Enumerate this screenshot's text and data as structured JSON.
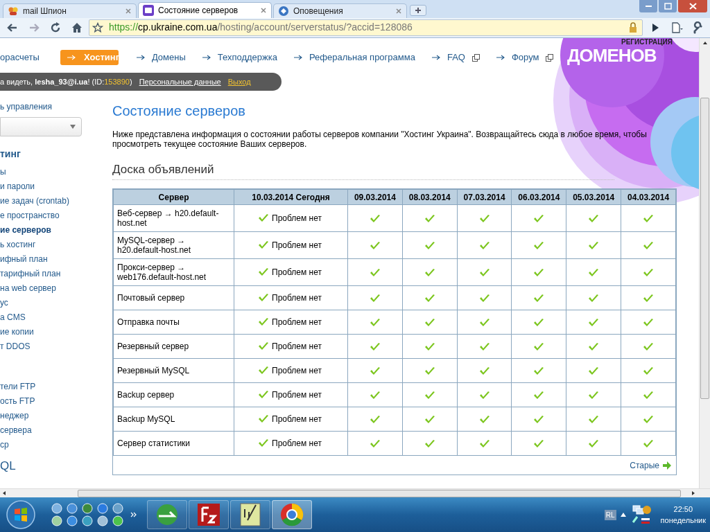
{
  "browser": {
    "tabs": [
      {
        "title": "mail Шпион",
        "selected": false
      },
      {
        "title": "Состояние серверов",
        "selected": true
      },
      {
        "title": "Оповещения",
        "selected": false
      }
    ],
    "url": {
      "scheme": "https://",
      "host": "cp.ukraine.com.ua",
      "path": "/hosting/account/serverstatus/?accid=128086"
    }
  },
  "nav": [
    {
      "label": "орасчеты",
      "selected": false
    },
    {
      "label": "Хостинг",
      "selected": true
    },
    {
      "label": "Домены",
      "selected": false
    },
    {
      "label": "Техподдержка",
      "selected": false
    },
    {
      "label": "Реферальная программа",
      "selected": false
    },
    {
      "label": "FAQ",
      "selected": false,
      "external": true
    },
    {
      "label": "Форум",
      "selected": false,
      "external": true
    }
  ],
  "banner": {
    "top": "РЕГИСТРАЦИЯ",
    "main": "ДОМЕНОВ"
  },
  "user_bar": {
    "greeting": "а видеть, **lesha_93@i.ua**! (ID:",
    "id": "153890",
    "close": ")",
    "links": [
      "Персональные данные",
      "Выход"
    ]
  },
  "sidebar": {
    "title": "ь управления",
    "groups": [
      {
        "heading": "тинг",
        "items": [
          {
            "label": "ы",
            "selected": false
          },
          {
            "label": "и пароли",
            "selected": false
          },
          {
            "label": "ие задач (crontab)",
            "selected": false
          },
          {
            "label": "е пространство",
            "selected": false
          },
          {
            "label": "ие серверов",
            "selected": true
          },
          {
            "label": "ь хостинг",
            "selected": false
          },
          {
            "label": "ифный план",
            "selected": false
          },
          {
            "label": "тарифный план",
            "selected": false
          },
          {
            "label": "на web сервер",
            "selected": false
          },
          {
            "label": "ус",
            "selected": false
          },
          {
            "label": "а CMS",
            "selected": false
          },
          {
            "label": "ие копии",
            "selected": false
          },
          {
            "label": "т DDOS",
            "selected": false
          }
        ]
      },
      {
        "items": [
          {
            "label": "тели FTP",
            "selected": false
          },
          {
            "label": "ость FTP",
            "selected": false
          },
          {
            "label": "неджер",
            "selected": false
          },
          {
            "label": "сервера",
            "selected": false
          },
          {
            "label": "ср",
            "selected": false
          }
        ]
      },
      {
        "heading": "QL"
      }
    ]
  },
  "main": {
    "title": "Состояние серверов",
    "intro": "Ниже представлена информация о состоянии работы серверов компании \"Хостинг Украина\". Возвращайтесь сюда в любое время, чтобы просмотреть текущее состояние Ваших серверов.",
    "board_title": "Доска объявлений",
    "table": {
      "columns": [
        "Сервер",
        "10.03.2014 Сегодня",
        "09.03.2014",
        "08.03.2014",
        "07.03.2014",
        "06.03.2014",
        "05.03.2014",
        "04.03.2014"
      ],
      "rows": [
        {
          "server": "Веб-сервер → h20.default-host.net",
          "today": {
            "ok": true,
            "text": "Проблем нет"
          },
          "days": [
            {
              "ok": true
            },
            {
              "ok": true
            },
            {
              "ok": true
            },
            {
              "ok": true
            },
            {
              "ok": true
            },
            {
              "ok": true
            }
          ]
        },
        {
          "server": "MySQL-сервер → h20.default-host.net",
          "today": {
            "ok": true,
            "text": "Проблем нет"
          },
          "days": [
            {
              "ok": true
            },
            {
              "ok": true
            },
            {
              "ok": true
            },
            {
              "ok": true
            },
            {
              "ok": true
            },
            {
              "ok": true
            }
          ]
        },
        {
          "server": "Прокси-сервер → web176.default-host.net",
          "today": {
            "ok": true,
            "text": "Проблем нет"
          },
          "days": [
            {
              "ok": true
            },
            {
              "ok": true
            },
            {
              "ok": true
            },
            {
              "ok": true
            },
            {
              "ok": true
            },
            {
              "ok": true
            }
          ]
        },
        {
          "server": "Почтовый сервер",
          "today": {
            "ok": true,
            "text": "Проблем нет"
          },
          "days": [
            {
              "ok": true
            },
            {
              "ok": true
            },
            {
              "ok": true
            },
            {
              "ok": true
            },
            {
              "ok": true
            },
            {
              "ok": true
            }
          ]
        },
        {
          "server": "Отправка почты",
          "today": {
            "ok": true,
            "text": "Проблем нет"
          },
          "days": [
            {
              "ok": true
            },
            {
              "ok": true
            },
            {
              "ok": true
            },
            {
              "ok": true
            },
            {
              "ok": true
            },
            {
              "ok": true
            }
          ]
        },
        {
          "server": "Резервный сервер",
          "today": {
            "ok": true,
            "text": "Проблем нет"
          },
          "days": [
            {
              "ok": true
            },
            {
              "ok": true
            },
            {
              "ok": true
            },
            {
              "ok": true
            },
            {
              "ok": true
            },
            {
              "ok": true
            }
          ]
        },
        {
          "server": "Резервный MySQL",
          "today": {
            "ok": true,
            "text": "Проблем нет"
          },
          "days": [
            {
              "ok": true
            },
            {
              "ok": true
            },
            {
              "ok": true
            },
            {
              "ok": true
            },
            {
              "ok": true
            },
            {
              "ok": true
            }
          ]
        },
        {
          "server": "Backup сервер",
          "today": {
            "ok": true,
            "text": "Проблем нет"
          },
          "days": [
            {
              "ok": true
            },
            {
              "ok": true
            },
            {
              "ok": true
            },
            {
              "ok": true
            },
            {
              "ok": true
            },
            {
              "ok": true
            }
          ]
        },
        {
          "server": "Backup MySQL",
          "today": {
            "ok": true,
            "text": "Проблем нет"
          },
          "days": [
            {
              "ok": true
            },
            {
              "ok": true
            },
            {
              "ok": true
            },
            {
              "ok": true
            },
            {
              "ok": true
            },
            {
              "ok": true
            }
          ]
        },
        {
          "server": "Сервер статистики",
          "today": {
            "ok": true,
            "text": "Проблем нет"
          },
          "days": [
            {
              "ok": true
            },
            {
              "ok": true
            },
            {
              "ok": true
            },
            {
              "ok": true
            },
            {
              "ok": true
            },
            {
              "ok": true
            }
          ]
        }
      ]
    },
    "older_link": "Старые"
  },
  "taskbar": {
    "tray": {
      "language": "RL",
      "time": "22:50",
      "day": "понедельник"
    }
  }
}
